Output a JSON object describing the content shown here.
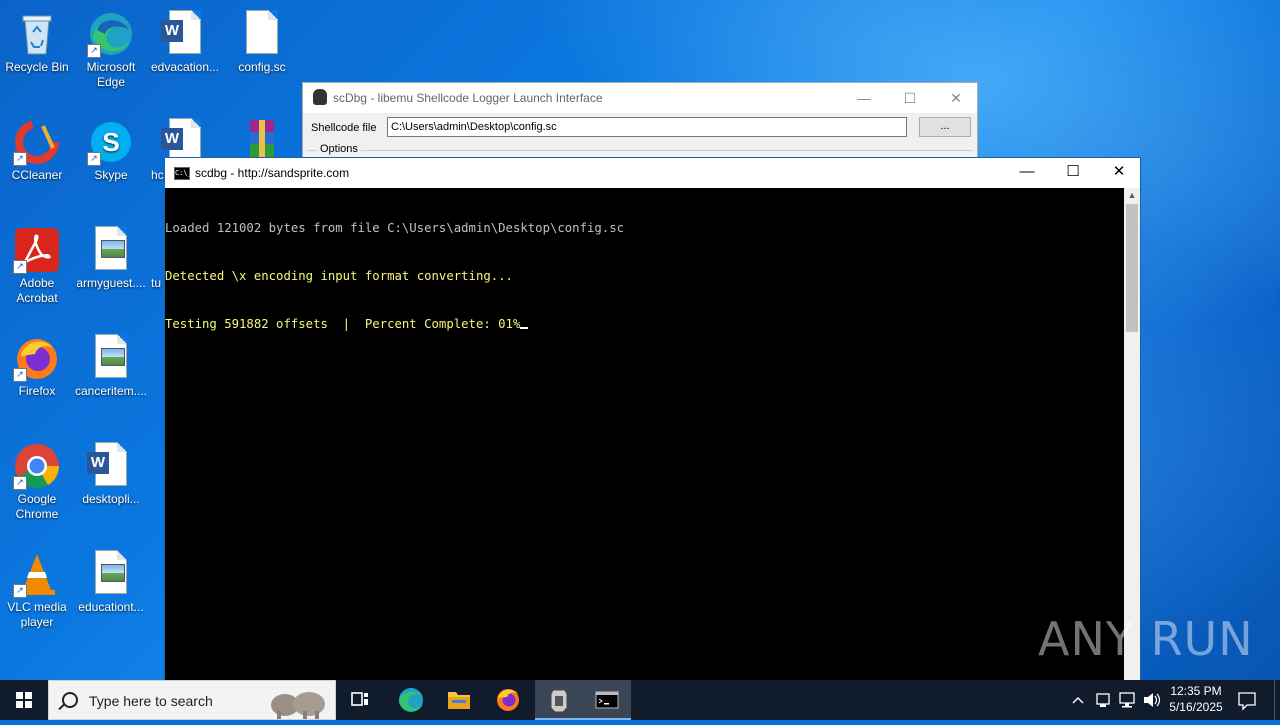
{
  "desktop": {
    "icons": [
      {
        "label": "Recycle Bin"
      },
      {
        "label": "Microsoft Edge"
      },
      {
        "label": "edvacation..."
      },
      {
        "label": "config.sc"
      },
      {
        "label": "CCleaner"
      },
      {
        "label": "Skype"
      },
      {
        "label": "hc"
      },
      {
        "label": "Adobe Acrobat"
      },
      {
        "label": "armyguest...."
      },
      {
        "label": "tu"
      },
      {
        "label": "Firefox"
      },
      {
        "label": "canceritem...."
      },
      {
        "label": "Google Chrome"
      },
      {
        "label": "desktopli..."
      },
      {
        "label": "VLC media player"
      },
      {
        "label": "educationt..."
      }
    ]
  },
  "scdbg_window": {
    "title": "scDbg - libemu Shellcode Logger Launch Interface",
    "shellcode_label": "Shellcode file",
    "shellcode_path": "C:\\Users\\admin\\Desktop\\config.sc",
    "browse_label": "...",
    "options_label": "Options",
    "minimize": "—",
    "maximize": "☐",
    "close": "✕"
  },
  "console_window": {
    "title": "scdbg - http://sandsprite.com",
    "icon_text": "C:\\_",
    "minimize": "—",
    "maximize": "☐",
    "close": "✕",
    "lines": [
      "Loaded 121002 bytes from file C:\\Users\\admin\\Desktop\\config.sc",
      "Detected \\x encoding input format converting...",
      "Testing 591882 offsets  |  Percent Complete: 01%"
    ]
  },
  "watermark": "ANY RUN",
  "taskbar": {
    "search_placeholder": "Type here to search",
    "time": "12:35 PM",
    "date": "5/16/2025"
  }
}
